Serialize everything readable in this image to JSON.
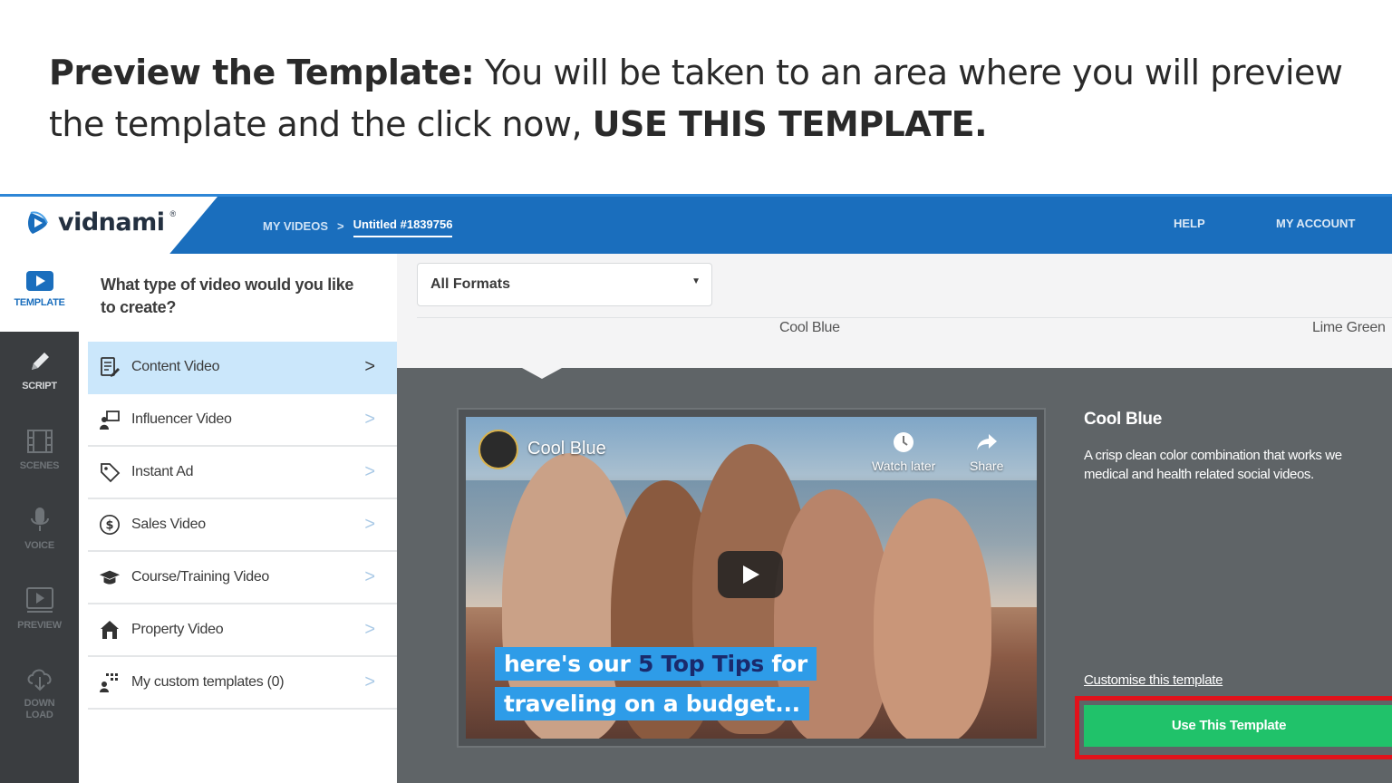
{
  "caption": {
    "bold_lead": "Preview the Template:",
    "text": " You will be taken to an area where you will preview the template and the click now, ",
    "bold_tail": "USE THIS TEMPLATE."
  },
  "header": {
    "logo_text": "vidnami",
    "logo_mark": "®",
    "breadcrumb_parent": "MY VIDEOS",
    "breadcrumb_sep": ">",
    "breadcrumb_current": "Untitled #1839756",
    "help": "HELP",
    "account": "MY ACCOUNT"
  },
  "rail": {
    "template": "TEMPLATE",
    "script": "SCRIPT",
    "scenes": "SCENES",
    "voice": "VOICE",
    "preview": "PREVIEW",
    "download_1": "DOWN",
    "download_2": "LOAD"
  },
  "categories": {
    "question": "What type of video would you like to create?",
    "items": [
      {
        "label": "Content Video",
        "icon": "content-doc-icon"
      },
      {
        "label": "Influencer Video",
        "icon": "presenter-icon"
      },
      {
        "label": "Instant Ad",
        "icon": "tag-icon"
      },
      {
        "label": "Sales Video",
        "icon": "dollar-icon"
      },
      {
        "label": "Course/Training Video",
        "icon": "grad-cap-icon"
      },
      {
        "label": "Property Video",
        "icon": "house-icon"
      },
      {
        "label": "My custom templates (0)",
        "icon": "custom-templates-icon"
      }
    ],
    "chevron": ">"
  },
  "formats": {
    "selected": "All Formats",
    "templates": [
      "Cool Blue",
      "Lime Green"
    ]
  },
  "video": {
    "title": "Cool Blue",
    "watch_later": "Watch later",
    "share": "Share",
    "caption_line1_a": "here's our ",
    "caption_line1_b": "5 Top Tips",
    "caption_line1_c": " for",
    "caption_line2": "traveling on a budget..."
  },
  "details": {
    "title": "Cool Blue",
    "description_1": "A crisp clean color combination that works we",
    "description_2": "medical and health related social videos.",
    "customise_link": "Customise this template",
    "use_button": "Use This Template",
    "button_color": "#20c26a",
    "highlight_color": "#e1121b"
  }
}
